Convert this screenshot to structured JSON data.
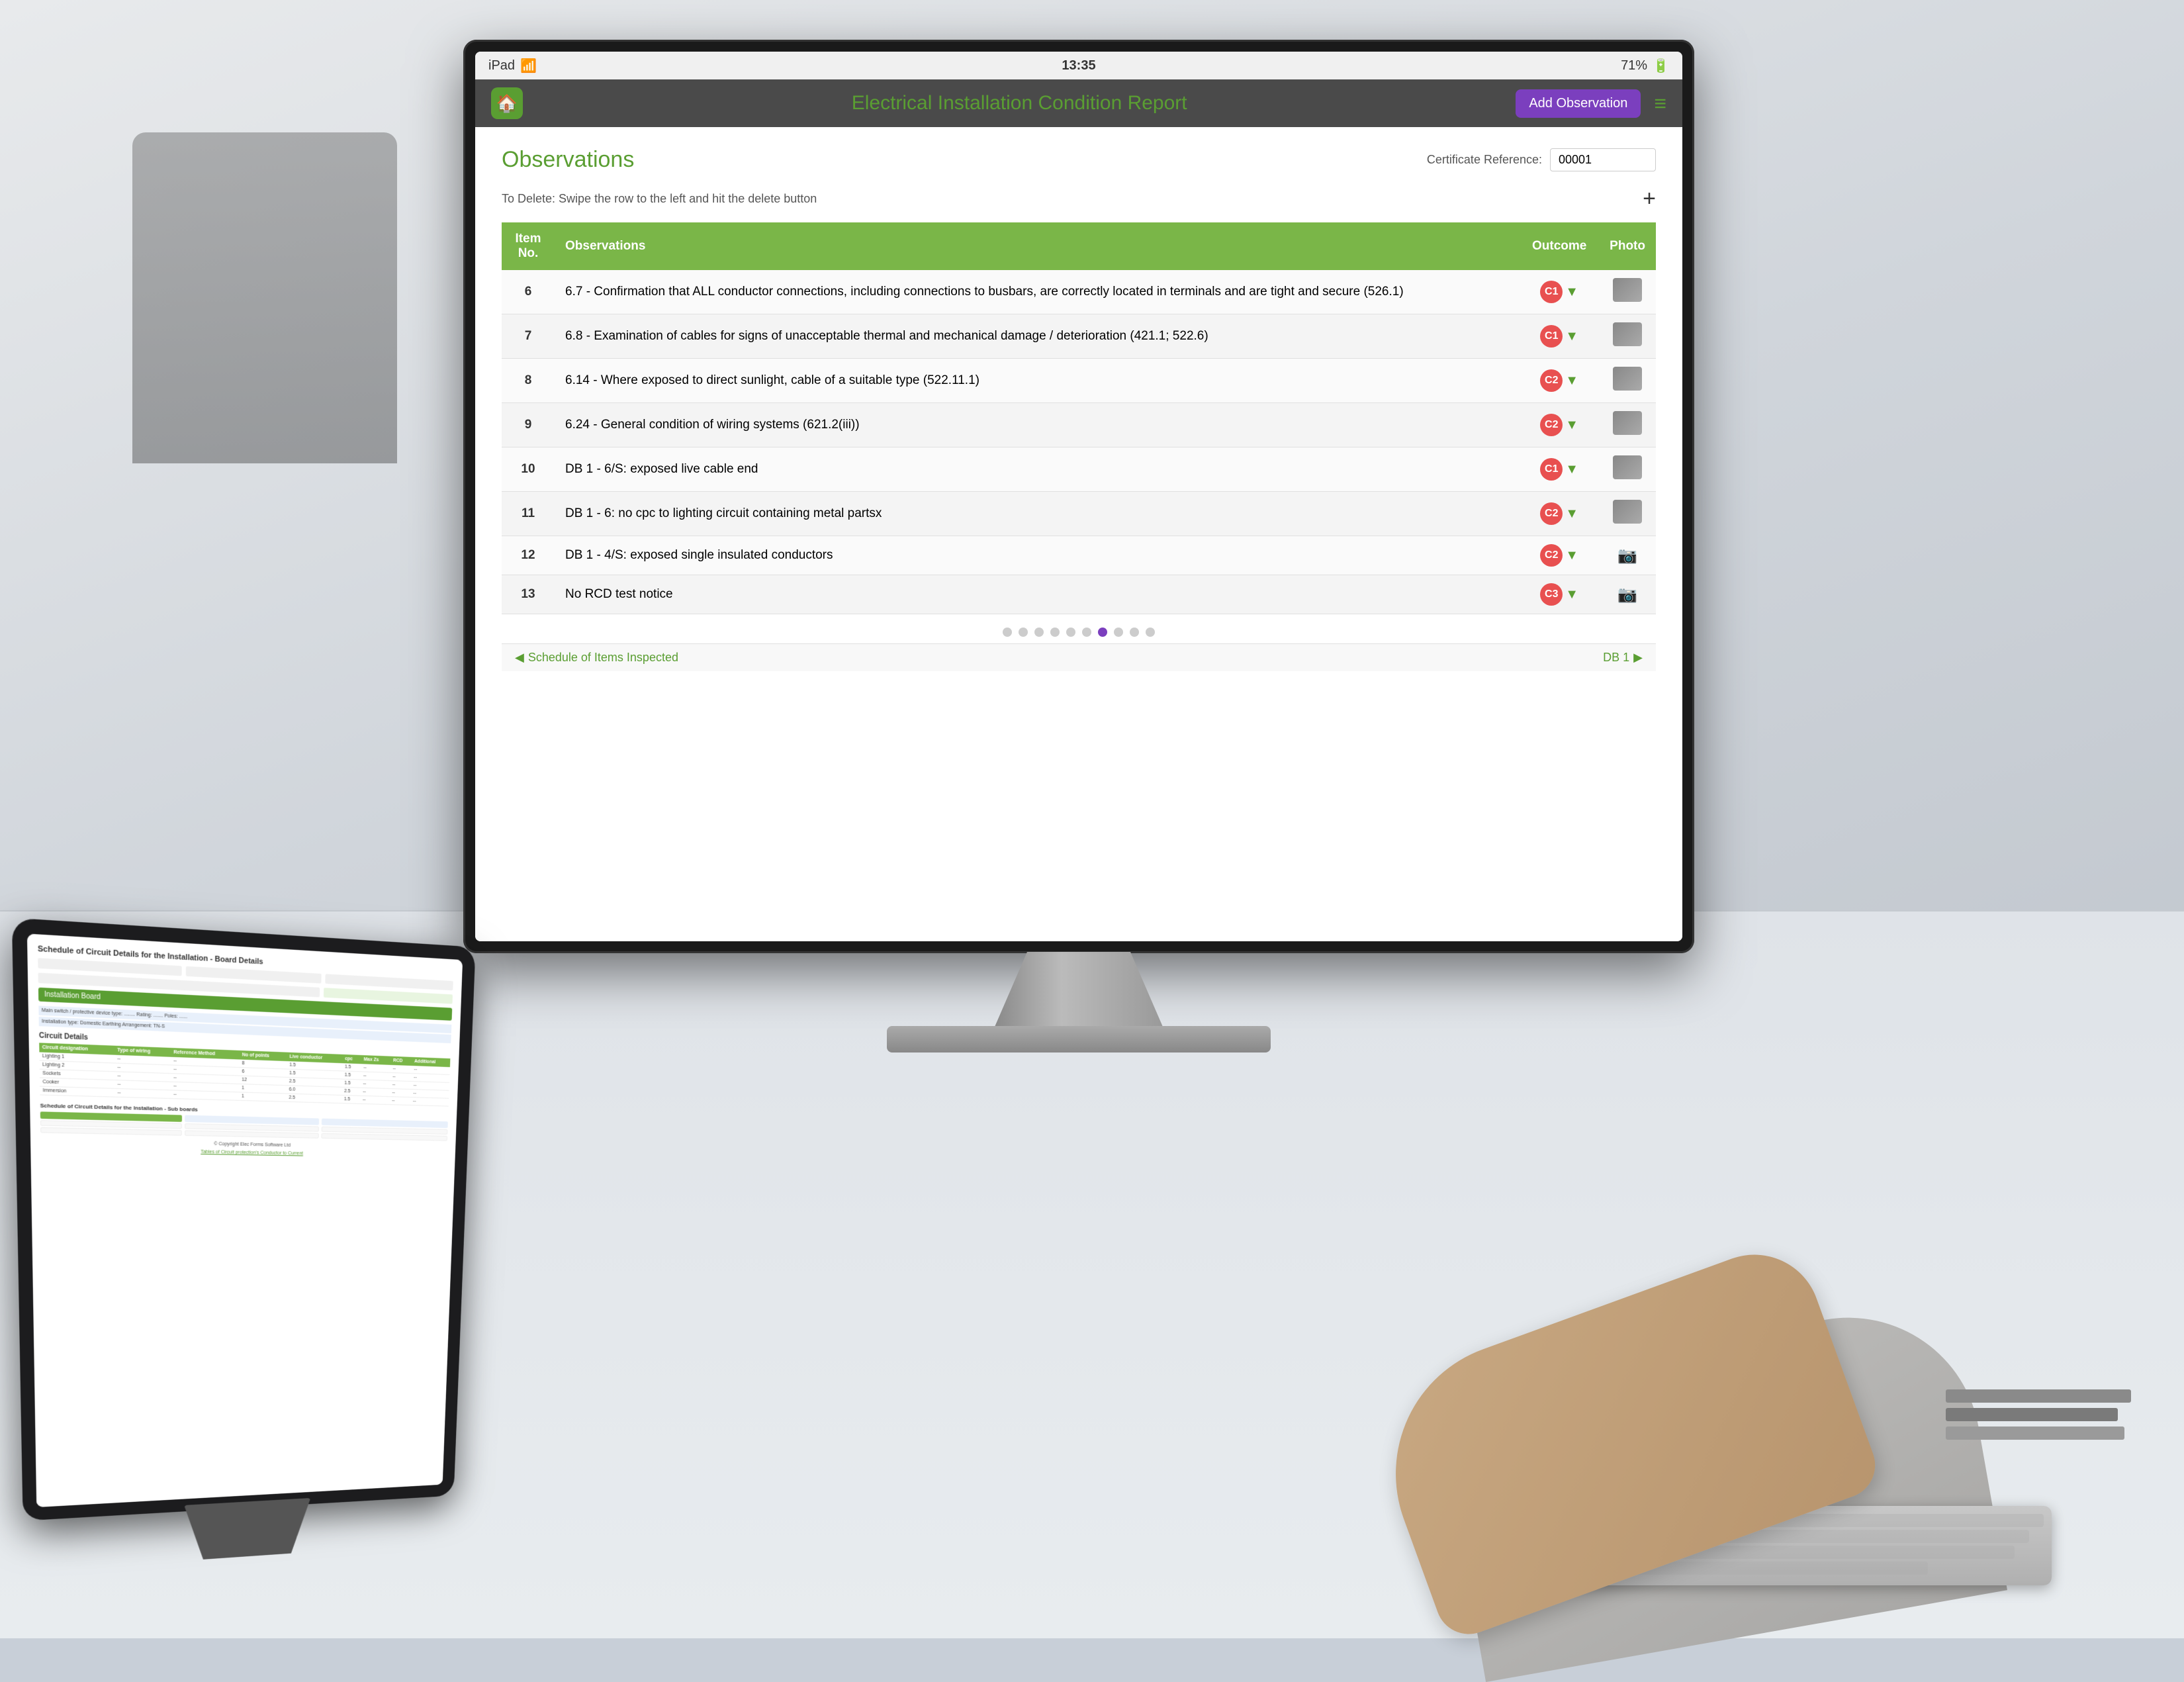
{
  "scene": {
    "title": "Electrical Installation Condition Report App on Monitor and iPad"
  },
  "status_bar": {
    "left_label": "iPad",
    "wifi_icon": "wifi",
    "time": "13:35",
    "battery_percent": "71%",
    "battery_icon": "battery"
  },
  "header": {
    "home_icon": "🏠",
    "title": "Electrical Installation Condition Report",
    "add_observation_label": "Add Observation",
    "menu_icon": "≡"
  },
  "observations": {
    "title": "Observations",
    "cert_ref_label": "Certificate Reference:",
    "cert_ref_value": "00001",
    "delete_hint": "To Delete: Swipe the row to the left and hit the delete button",
    "plus_icon": "+",
    "table": {
      "columns": [
        "Item No.",
        "Observations",
        "Outcome",
        "Photo"
      ],
      "rows": [
        {
          "item_no": "6",
          "description": "6.7 - Confirmation that ALL conductor connections, including connections to busbars, are correctly located in terminals and are tight and secure (526.1)",
          "outcome": "C1",
          "has_photo": true
        },
        {
          "item_no": "7",
          "description": "6.8 - Examination of cables for signs of unacceptable thermal and mechanical damage / deterioration (421.1; 522.6)",
          "outcome": "C1",
          "has_photo": true
        },
        {
          "item_no": "8",
          "description": "6.14 - Where exposed to direct sunlight, cable of a suitable type (522.11.1)",
          "outcome": "C2",
          "has_photo": true
        },
        {
          "item_no": "9",
          "description": "6.24 - General condition of wiring systems (621.2(iii))",
          "outcome": "C2",
          "has_photo": true
        },
        {
          "item_no": "10",
          "description": "DB 1 - 6/S: exposed live cable end",
          "outcome": "C1",
          "has_photo": true
        },
        {
          "item_no": "11",
          "description": "DB 1 - 6: no cpc to lighting circuit containing metal partsx",
          "outcome": "C2",
          "has_photo": true
        },
        {
          "item_no": "12",
          "description": "DB 1 - 4/S: exposed single insulated conductors",
          "outcome": "C2",
          "has_photo": false
        },
        {
          "item_no": "13",
          "description": "No RCD test notice",
          "outcome": "C3",
          "has_photo": false
        }
      ]
    },
    "pagination_total": 10,
    "pagination_active": 7,
    "nav_back_label": "Schedule of Items Inspected",
    "nav_forward_label": "DB 1"
  },
  "ipad": {
    "section_title": "Schedule of Circuit Details for the Installation - Board Details",
    "circuit_title": "Circuit Details",
    "sub_section": "Schedule of Circuit Details for the Installation - Sub boards"
  },
  "colors": {
    "green": "#7ab648",
    "dark_green": "#5a9e32",
    "purple": "#7b3fbe",
    "red": "#e85050",
    "table_header_bg": "#7ab648"
  }
}
